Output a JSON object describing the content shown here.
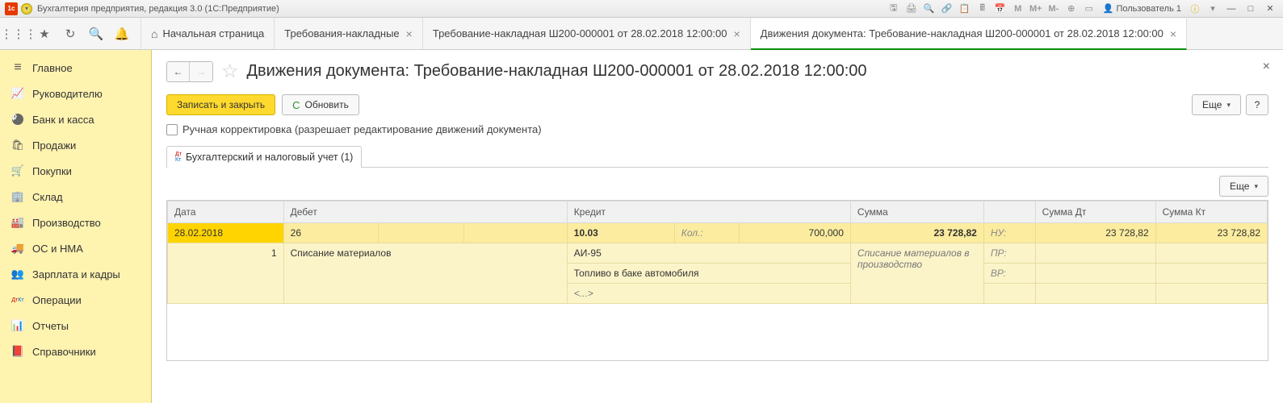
{
  "titlebar": {
    "title": "Бухгалтерия предприятия, редакция 3.0  (1С:Предприятие)",
    "user_label": "Пользователь 1"
  },
  "toolbar_m": {
    "m": "M",
    "mplus": "M+",
    "mminus": "M-"
  },
  "tabs": {
    "home": "Начальная страница",
    "t1": "Требования-накладные",
    "t2": "Требование-накладная Ш200-000001 от 28.02.2018 12:00:00",
    "t3": "Движения документа: Требование-накладная Ш200-000001 от 28.02.2018 12:00:00"
  },
  "sidebar": {
    "items": [
      "Главное",
      "Руководителю",
      "Банк и касса",
      "Продажи",
      "Покупки",
      "Склад",
      "Производство",
      "ОС и НМА",
      "Зарплата и кадры",
      "Операции",
      "Отчеты",
      "Справочники"
    ]
  },
  "page": {
    "title": "Движения документа: Требование-накладная Ш200-000001 от 28.02.2018 12:00:00",
    "btn_save_close": "Записать и закрыть",
    "btn_refresh": "Обновить",
    "btn_more": "Еще",
    "btn_help": "?",
    "checkbox_label": "Ручная корректировка (разрешает редактирование движений документа)",
    "tab_accounting": "Бухгалтерский и налоговый учет (1)"
  },
  "grid": {
    "headers": {
      "date": "Дата",
      "debit": "Дебет",
      "credit": "Кредит",
      "sum": "Сумма",
      "sum_dt": "Сумма Дт",
      "sum_kt": "Сумма Кт"
    },
    "row1": {
      "date": "28.02.2018",
      "num": "1",
      "debit_acc": "26",
      "debit_desc": "Списание материалов",
      "credit_acc": "10.03",
      "credit_qty_label": "Кол.:",
      "credit_qty": "700,000",
      "credit_item1": "АИ-95",
      "credit_item2": "Топливо в баке автомобиля",
      "credit_item3": "<...>",
      "sum": "23 728,82",
      "sum_desc": "Списание материалов в производство",
      "nu_label": "НУ:",
      "pr_label": "ПР:",
      "vr_label": "ВР:",
      "sum_dt": "23 728,82",
      "sum_kt": "23 728,82"
    }
  }
}
